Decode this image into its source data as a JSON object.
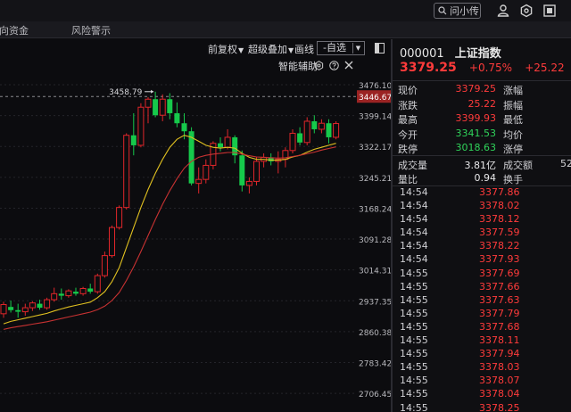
{
  "topbar": {
    "search_label": "问小传"
  },
  "tabs": [
    {
      "label": "向资金"
    },
    {
      "label": "风险警示"
    }
  ],
  "toolbar": {
    "fq_label": "前复权",
    "overlay_label": "超级叠加",
    "draw_label": "画线",
    "self_select_label": "-自选"
  },
  "assist": {
    "label": "智能辅助"
  },
  "chart_data": {
    "type": "candlestick",
    "max_annotation": "3458.79",
    "last_price_label": "3446.67",
    "last_price_line": 3446.67,
    "ylim": [
      2660,
      3505
    ],
    "y_ticks": [
      "3476.10",
      "3399.14",
      "3322.17",
      "3245.21",
      "3168.24",
      "3091.28",
      "3014.31",
      "2937.35",
      "2860.38",
      "2783.42",
      "2706.45"
    ],
    "grid": true,
    "candles": [
      [
        2905,
        2935,
        2895,
        2928
      ],
      [
        2922,
        2938,
        2908,
        2914
      ],
      [
        2914,
        2930,
        2895,
        2910
      ],
      [
        2910,
        2930,
        2900,
        2920
      ],
      [
        2920,
        2936,
        2912,
        2932
      ],
      [
        2930,
        2940,
        2915,
        2920
      ],
      [
        2920,
        2945,
        2915,
        2940
      ],
      [
        2940,
        2970,
        2935,
        2955
      ],
      [
        2955,
        2968,
        2940,
        2950
      ],
      [
        2950,
        2966,
        2945,
        2962
      ],
      [
        2960,
        2970,
        2950,
        2955
      ],
      [
        2955,
        2972,
        2950,
        2968
      ],
      [
        2968,
        2980,
        2955,
        2960
      ],
      [
        2960,
        3005,
        2955,
        3000
      ],
      [
        3000,
        3060,
        2995,
        3050
      ],
      [
        3050,
        3125,
        3045,
        3120
      ],
      [
        3120,
        3175,
        3115,
        3170
      ],
      [
        3170,
        3355,
        3165,
        3350
      ],
      [
        3350,
        3405,
        3300,
        3325
      ],
      [
        3325,
        3430,
        3320,
        3420
      ],
      [
        3420,
        3445,
        3380,
        3440
      ],
      [
        3440,
        3458.79,
        3395,
        3400
      ],
      [
        3400,
        3452,
        3385,
        3440
      ],
      [
        3440,
        3455,
        3390,
        3405
      ],
      [
        3405,
        3432,
        3370,
        3380
      ],
      [
        3380,
        3405,
        3340,
        3360
      ],
      [
        3360,
        3370,
        3225,
        3230
      ],
      [
        3230,
        3270,
        3205,
        3240
      ],
      [
        3240,
        3290,
        3230,
        3275
      ],
      [
        3275,
        3335,
        3265,
        3330
      ],
      [
        3330,
        3345,
        3310,
        3320
      ],
      [
        3320,
        3365,
        3315,
        3345
      ],
      [
        3345,
        3350,
        3280,
        3300
      ],
      [
        3300,
        3312,
        3210,
        3225
      ],
      [
        3225,
        3245,
        3205,
        3235
      ],
      [
        3235,
        3295,
        3225,
        3285
      ],
      [
        3285,
        3305,
        3270,
        3295
      ],
      [
        3295,
        3305,
        3275,
        3285
      ],
      [
        3285,
        3310,
        3255,
        3290
      ],
      [
        3290,
        3320,
        3270,
        3312
      ],
      [
        3312,
        3365,
        3305,
        3355
      ],
      [
        3355,
        3370,
        3325,
        3332
      ],
      [
        3332,
        3395,
        3325,
        3385
      ],
      [
        3385,
        3400,
        3355,
        3365
      ],
      [
        3365,
        3390,
        3355,
        3380
      ],
      [
        3380,
        3390,
        3330,
        3345
      ],
      [
        3345,
        3385,
        3340,
        3379.25
      ]
    ],
    "ma_series": [
      {
        "color": "#e0c020",
        "values": [
          2880,
          2886,
          2890,
          2894,
          2898,
          2902,
          2906,
          2912,
          2917,
          2922,
          2926,
          2930,
          2934,
          2945,
          2960,
          2985,
          3020,
          3070,
          3120,
          3170,
          3215,
          3255,
          3290,
          3320,
          3340,
          3350,
          3345,
          3335,
          3325,
          3320,
          3318,
          3320,
          3318,
          3305,
          3295,
          3290,
          3290,
          3288,
          3288,
          3290,
          3296,
          3300,
          3308,
          3315,
          3320,
          3325,
          3330
        ]
      },
      {
        "color": "#c83232",
        "values": [
          2866,
          2870,
          2873,
          2876,
          2879,
          2882,
          2885,
          2889,
          2893,
          2897,
          2901,
          2905,
          2909,
          2915,
          2924,
          2938,
          2958,
          2988,
          3022,
          3060,
          3100,
          3140,
          3178,
          3212,
          3242,
          3268,
          3285,
          3295,
          3300,
          3303,
          3305,
          3307,
          3307,
          3303,
          3299,
          3296,
          3295,
          3294,
          3293,
          3294,
          3297,
          3300,
          3304,
          3308,
          3313,
          3317,
          3321
        ]
      }
    ]
  },
  "quote": {
    "code": "000001",
    "name": "上证指数",
    "price": "3379.25",
    "pct": "+0.75%",
    "change": "+25.22"
  },
  "stats": [
    {
      "l1": "现价",
      "v1": "3379.25",
      "c1": "red",
      "l2": "涨幅",
      "v2": ""
    },
    {
      "l1": "涨跌",
      "v1": "25.22",
      "c1": "red",
      "l2": "振幅",
      "v2": ""
    },
    {
      "l1": "最高",
      "v1": "3399.93",
      "c1": "red",
      "l2": "最低",
      "v2": ""
    },
    {
      "l1": "今开",
      "v1": "3341.53",
      "c1": "green",
      "l2": "均价",
      "v2": ""
    },
    {
      "l1": "跌停",
      "v1": "3018.63",
      "c1": "green",
      "l2": "涨停",
      "v2": ""
    },
    {
      "l1": "成交量",
      "v1": "3.81亿",
      "c1": "white",
      "l2": "成交额",
      "v2": "52"
    },
    {
      "l1": "量比",
      "v1": "0.94",
      "c1": "white",
      "l2": "换手",
      "v2": ""
    }
  ],
  "ticks": [
    {
      "time": "14:54",
      "price": "3377.86"
    },
    {
      "time": "14:54",
      "price": "3378.02"
    },
    {
      "time": "14:54",
      "price": "3378.12"
    },
    {
      "time": "14:54",
      "price": "3377.59"
    },
    {
      "time": "14:54",
      "price": "3378.22"
    },
    {
      "time": "14:54",
      "price": "3377.93"
    },
    {
      "time": "14:55",
      "price": "3377.69"
    },
    {
      "time": "14:55",
      "price": "3377.66"
    },
    {
      "time": "14:55",
      "price": "3377.63"
    },
    {
      "time": "14:55",
      "price": "3377.79"
    },
    {
      "time": "14:55",
      "price": "3377.68"
    },
    {
      "time": "14:55",
      "price": "3378.11"
    },
    {
      "time": "14:55",
      "price": "3377.94"
    },
    {
      "time": "14:55",
      "price": "3378.03"
    },
    {
      "time": "14:55",
      "price": "3378.07"
    },
    {
      "time": "14:55",
      "price": "3378.04"
    },
    {
      "time": "14:55",
      "price": "3378.25"
    }
  ]
}
